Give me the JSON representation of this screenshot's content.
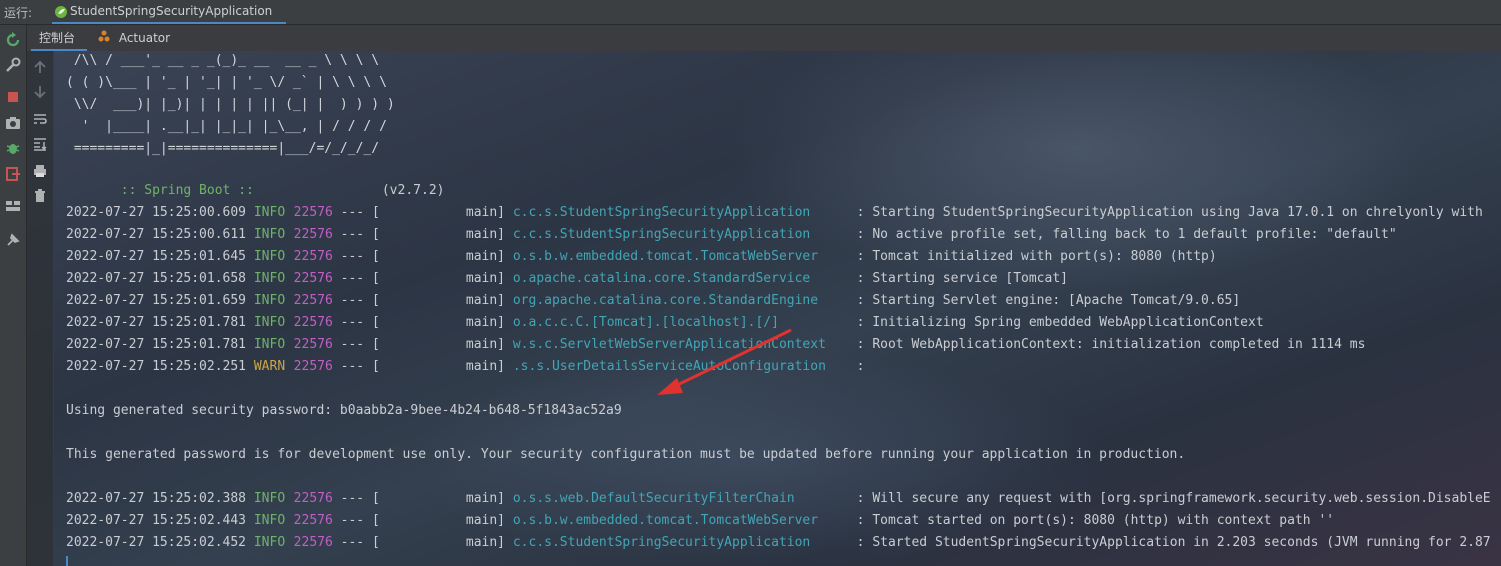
{
  "runbar": {
    "label": "运行:",
    "tab_title": "StudentSpringSecurityApplication"
  },
  "subtabs": {
    "console": "控制台",
    "actuator": "Actuator"
  },
  "icons": {
    "left_toolbar": [
      "rerun-icon",
      "wrench-icon",
      "stop-icon",
      "camera-icon",
      "bug-icon",
      "exit-icon",
      "layout-icon",
      "pin-icon"
    ],
    "console_toolbar": [
      "up-icon",
      "down-icon",
      "soft-wrap-icon",
      "scroll-end-icon",
      "print-icon",
      "trash-icon"
    ]
  },
  "colors": {
    "info": "#6fb36a",
    "warn": "#c9a649",
    "pid": "#c25fc4",
    "logger": "#41a6b5",
    "accent": "#4a88c7",
    "arrow": "#e0322e"
  },
  "console": {
    "banner": [
      " /\\\\ / ___'_ __ _ _(_)_ __  __ _ \\ \\ \\ \\",
      "( ( )\\___ | '_ | '_| | '_ \\/ _` | \\ \\ \\ \\",
      " \\\\/  ___)| |_)| | | | | || (_| |  ) ) ) )",
      "  '  |____| .__|_| |_|_| |_\\__, | / / / /",
      " =========|_|==============|___/=/_/_/_/"
    ],
    "boot_label": " :: Spring Boot ::",
    "boot_version": "(v2.7.2)",
    "logs": [
      {
        "ts": "2022-07-27 15:25:00.609",
        "level": "INFO",
        "pid": "22576",
        "sep": "--- [",
        "thread": "main]",
        "logger": "c.c.s.StudentSpringSecurityApplication",
        "msg": ": Starting StudentSpringSecurityApplication using Java 17.0.1 on chrelyonly with"
      },
      {
        "ts": "2022-07-27 15:25:00.611",
        "level": "INFO",
        "pid": "22576",
        "sep": "--- [",
        "thread": "main]",
        "logger": "c.c.s.StudentSpringSecurityApplication",
        "msg": ": No active profile set, falling back to 1 default profile: \"default\""
      },
      {
        "ts": "2022-07-27 15:25:01.645",
        "level": "INFO",
        "pid": "22576",
        "sep": "--- [",
        "thread": "main]",
        "logger": "o.s.b.w.embedded.tomcat.TomcatWebServer",
        "msg": ": Tomcat initialized with port(s): 8080 (http)"
      },
      {
        "ts": "2022-07-27 15:25:01.658",
        "level": "INFO",
        "pid": "22576",
        "sep": "--- [",
        "thread": "main]",
        "logger": "o.apache.catalina.core.StandardService",
        "msg": ": Starting service [Tomcat]"
      },
      {
        "ts": "2022-07-27 15:25:01.659",
        "level": "INFO",
        "pid": "22576",
        "sep": "--- [",
        "thread": "main]",
        "logger": "org.apache.catalina.core.StandardEngine",
        "msg": ": Starting Servlet engine: [Apache Tomcat/9.0.65]"
      },
      {
        "ts": "2022-07-27 15:25:01.781",
        "level": "INFO",
        "pid": "22576",
        "sep": "--- [",
        "thread": "main]",
        "logger": "o.a.c.c.C.[Tomcat].[localhost].[/]",
        "msg": ": Initializing Spring embedded WebApplicationContext"
      },
      {
        "ts": "2022-07-27 15:25:01.781",
        "level": "INFO",
        "pid": "22576",
        "sep": "--- [",
        "thread": "main]",
        "logger": "w.s.c.ServletWebServerApplicationContext",
        "msg": ": Root WebApplicationContext: initialization completed in 1114 ms"
      },
      {
        "ts": "2022-07-27 15:25:02.251",
        "level": "WARN",
        "pid": "22576",
        "sep": "--- [",
        "thread": "main]",
        "logger": ".s.s.UserDetailsServiceAutoConfiguration",
        "msg": ":"
      }
    ],
    "password_line": "Using generated security password: b0aabb2a-9bee-4b24-b648-5f1843ac52a9",
    "dev_line": "This generated password is for development use only. Your security configuration must be updated before running your application in production.",
    "logs2": [
      {
        "ts": "2022-07-27 15:25:02.388",
        "level": "INFO",
        "pid": "22576",
        "sep": "--- [",
        "thread": "main]",
        "logger": "o.s.s.web.DefaultSecurityFilterChain",
        "msg": ": Will secure any request with [org.springframework.security.web.session.DisableE"
      },
      {
        "ts": "2022-07-27 15:25:02.443",
        "level": "INFO",
        "pid": "22576",
        "sep": "--- [",
        "thread": "main]",
        "logger": "o.s.b.w.embedded.tomcat.TomcatWebServer",
        "msg": ": Tomcat started on port(s): 8080 (http) with context path ''"
      },
      {
        "ts": "2022-07-27 15:25:02.452",
        "level": "INFO",
        "pid": "22576",
        "sep": "--- [",
        "thread": "main]",
        "logger": "c.c.s.StudentSpringSecurityApplication",
        "msg": ": Started StudentSpringSecurityApplication in 2.203 seconds (JVM running for 2.87"
      }
    ]
  }
}
